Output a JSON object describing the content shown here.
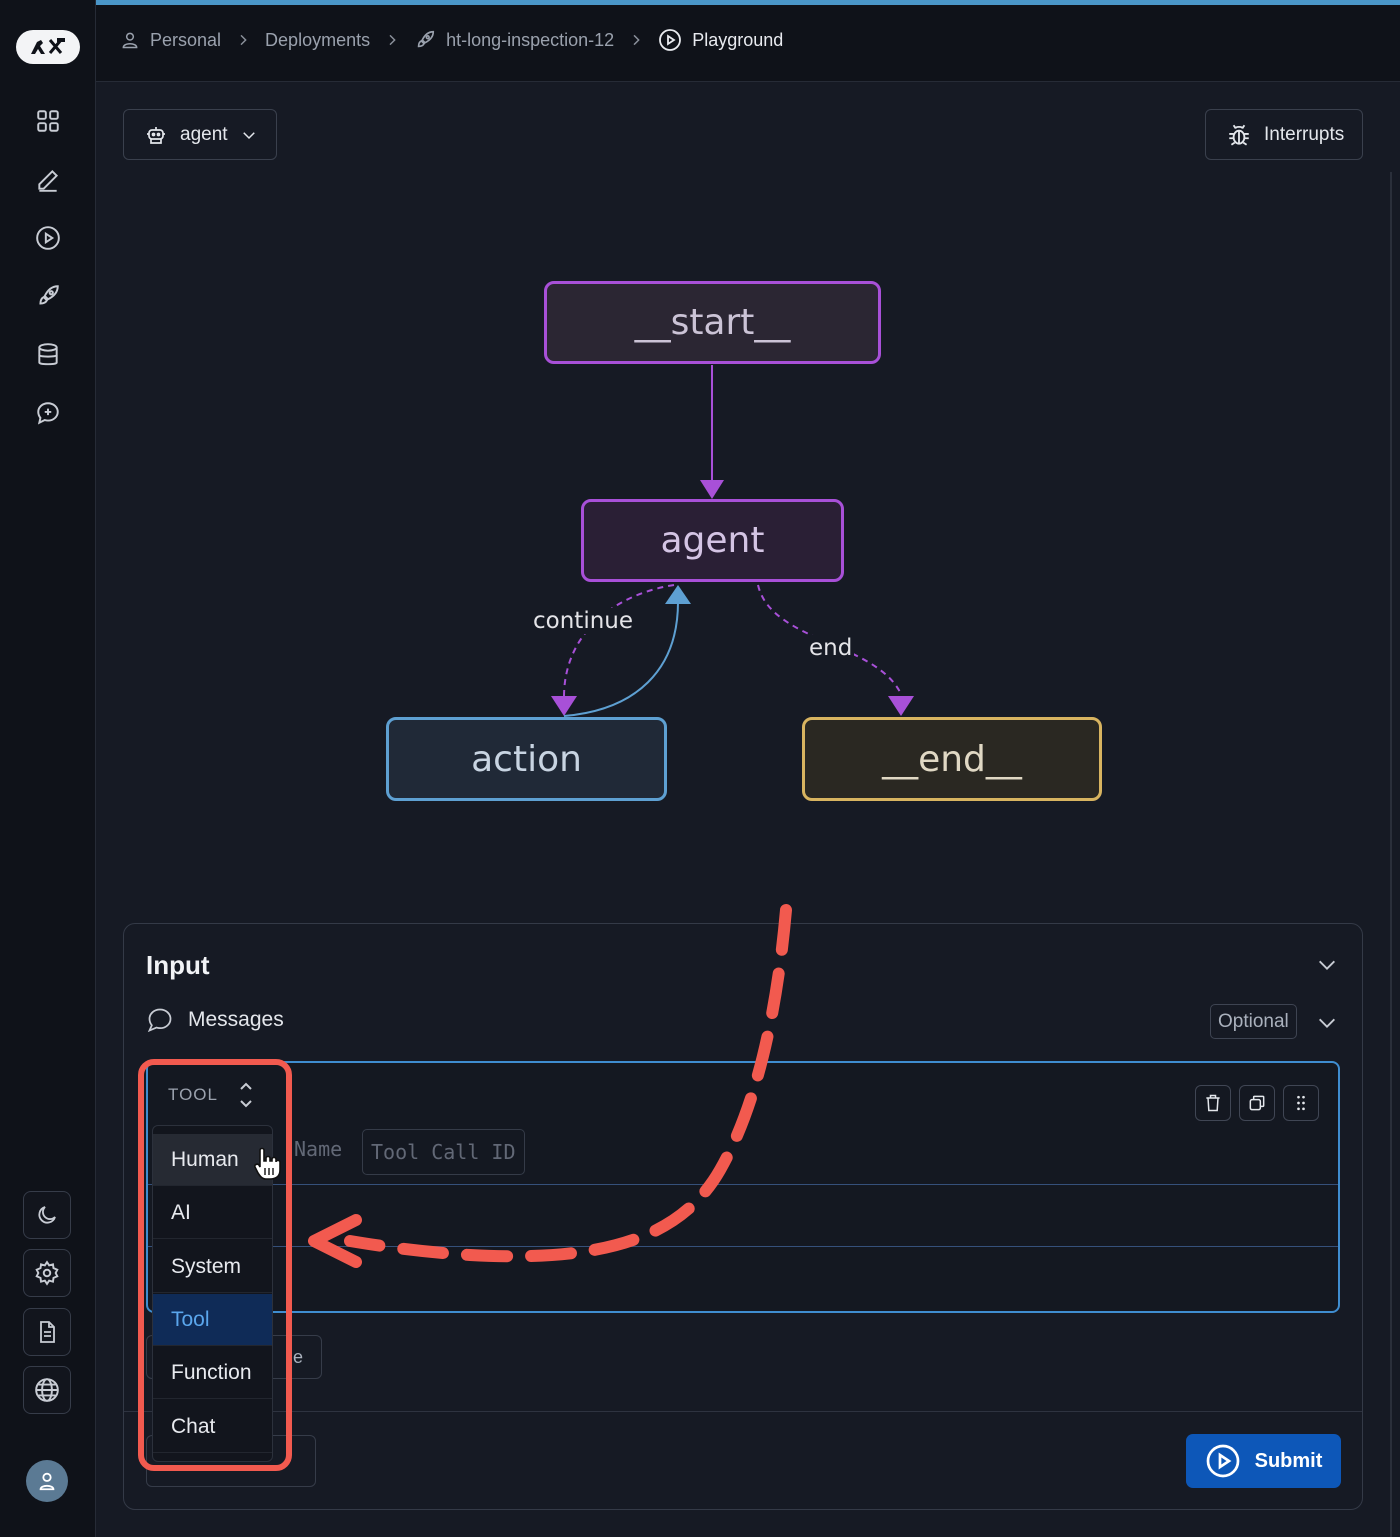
{
  "breadcrumbs": [
    {
      "label": "Personal",
      "icon": "user-icon"
    },
    {
      "label": "Deployments",
      "icon": ""
    },
    {
      "label": "ht-long-inspection-12",
      "icon": "rocket-icon"
    },
    {
      "label": "Playground",
      "icon": "play-circle-icon"
    }
  ],
  "sidebar": {
    "logo": "langsmith-logo",
    "nav_icons": [
      "grid-icon",
      "pencil-icon",
      "play-circle-icon",
      "rocket-icon",
      "database-icon",
      "chat-plus-icon"
    ],
    "bottom_icons": [
      "moon-icon",
      "gear-icon",
      "document-icon",
      "globe-icon"
    ]
  },
  "toolbar": {
    "graph_select_label": "agent",
    "interrupts_label": "Interrupts"
  },
  "graph": {
    "nodes": [
      {
        "id": "start",
        "label": "__start__"
      },
      {
        "id": "agent",
        "label": "agent"
      },
      {
        "id": "action",
        "label": "action"
      },
      {
        "id": "end",
        "label": "__end__"
      }
    ],
    "edges": [
      {
        "from": "start",
        "to": "agent",
        "label": ""
      },
      {
        "from": "agent",
        "to": "action",
        "label": "continue"
      },
      {
        "from": "action",
        "to": "agent",
        "label": ""
      },
      {
        "from": "agent",
        "to": "end",
        "label": "end"
      }
    ]
  },
  "input_panel": {
    "title": "Input",
    "messages_label": "Messages",
    "optional_badge": "Optional",
    "message": {
      "role": "TOOL",
      "name_placeholder_fragment": "Name",
      "tool_call_id_placeholder": "Tool Call ID"
    },
    "add_message_fragment": "e",
    "submit_label": "Submit"
  },
  "role_dropdown": {
    "options": [
      "Human",
      "AI",
      "System",
      "Tool",
      "Function",
      "Chat"
    ],
    "selected": "Tool",
    "hovered": "Human"
  },
  "colors": {
    "accent_blue": "#4a96c8",
    "submit_blue": "#0d57b8",
    "node_purple": "#a850d8",
    "node_blue": "#5ea0d2",
    "node_gold": "#d8b460",
    "annotation_red": "#f25a4f"
  }
}
